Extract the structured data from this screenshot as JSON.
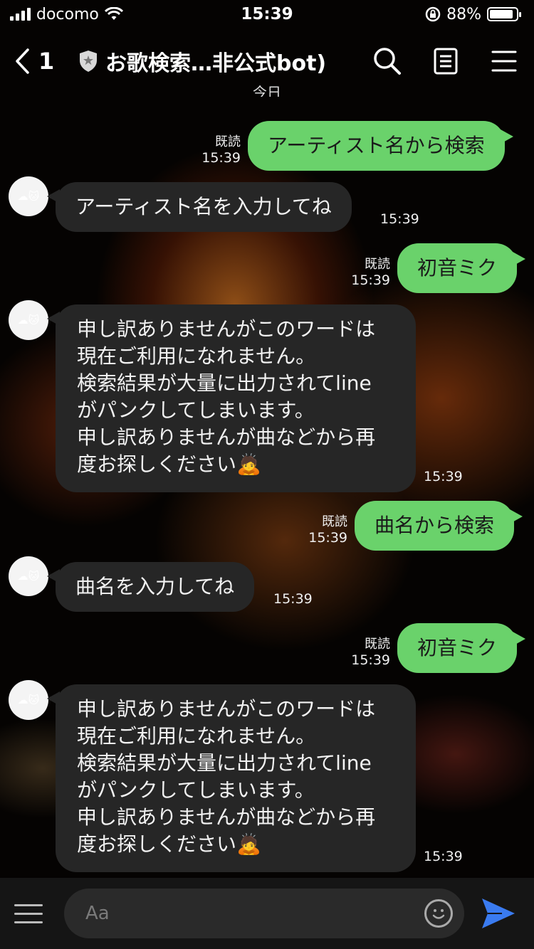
{
  "status_bar": {
    "carrier": "docomo",
    "time": "15:39",
    "battery": "88%",
    "battery_level": 0.88
  },
  "header": {
    "back_count": "1",
    "title": "お歌検索…非公式bot)",
    "icons": [
      "back-chevron-icon",
      "shield-star-icon",
      "search-icon",
      "notes-icon",
      "menu-icon"
    ]
  },
  "date_separator": "今日",
  "messages": [
    {
      "dir": "out",
      "text": "アーティスト名から検索",
      "read": "既読",
      "time": "15:39"
    },
    {
      "dir": "in",
      "text": "アーティスト名を入力してね",
      "time": "15:39"
    },
    {
      "dir": "out",
      "text": "初音ミク",
      "read": "既読",
      "time": "15:39"
    },
    {
      "dir": "in",
      "text": "申し訳ありませんがこのワードは\n現在ご利用になれません。\n検索結果が大量に出力されてline\nがパンクしてしまいます。\n申し訳ありませんが曲などから再\n度お探しください🙇",
      "time": "15:39"
    },
    {
      "dir": "out",
      "text": "曲名から検索",
      "read": "既読",
      "time": "15:39"
    },
    {
      "dir": "in",
      "text": "曲名を入力してね",
      "time": "15:39"
    },
    {
      "dir": "out",
      "text": "初音ミク",
      "read": "既読",
      "time": "15:39"
    },
    {
      "dir": "in",
      "text": "申し訳ありませんがこのワードは\n現在ご利用になれません。\n検索結果が大量に出力されてline\nがパンクしてしまいます。\n申し訳ありませんが曲などから再\n度お探しください🙇",
      "time": "15:39"
    }
  ],
  "bot_avatar": "☁🐱",
  "input": {
    "placeholder": "Aa"
  },
  "colors": {
    "outgoing_bubble": "#6ad26b",
    "incoming_bubble": "#262626",
    "send_arrow": "#3a7bf0"
  }
}
